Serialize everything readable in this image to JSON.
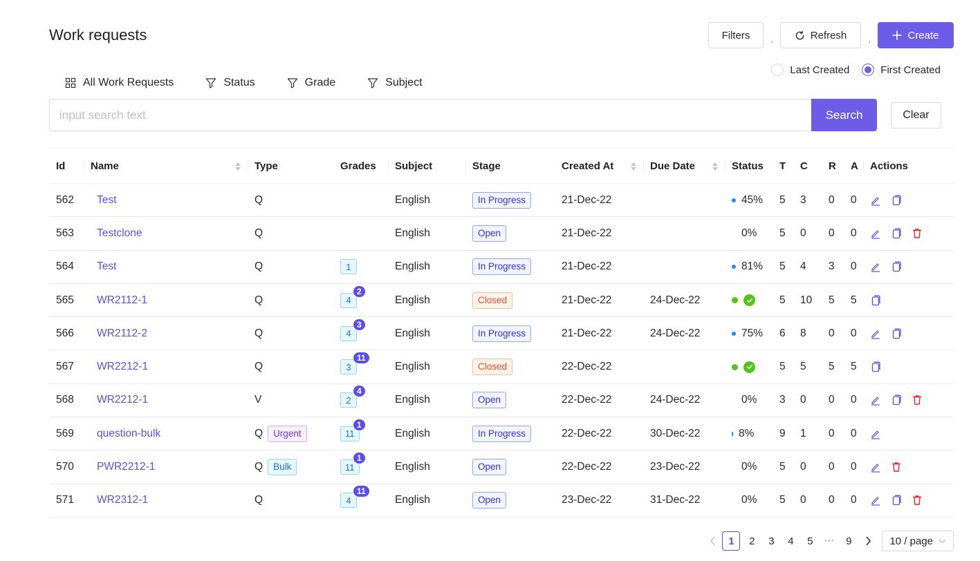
{
  "page": {
    "title": "Work requests"
  },
  "toolbar": {
    "filters_label": "Filters",
    "refresh_label": "Refresh",
    "create_label": "Create",
    "separator": ","
  },
  "sort_options": {
    "last_created": "Last Created",
    "first_created": "First Created",
    "selected": "first_created"
  },
  "tabs": [
    {
      "label": "All Work Requests",
      "icon": "grid-icon"
    },
    {
      "label": "Status",
      "icon": "filter-icon"
    },
    {
      "label": "Grade",
      "icon": "filter-icon"
    },
    {
      "label": "Subject",
      "icon": "filter-icon"
    }
  ],
  "search": {
    "placeholder": "input search text",
    "value": "",
    "button_label": "Search",
    "clear_label": "Clear"
  },
  "table": {
    "columns": {
      "id": "Id",
      "name": "Name",
      "type": "Type",
      "grades": "Grades",
      "subject": "Subject",
      "stage": "Stage",
      "created_at": "Created At",
      "due_date": "Due Date",
      "status": "Status",
      "t": "T",
      "c": "C",
      "r": "R",
      "a": "A",
      "actions": "Actions"
    },
    "rows": [
      {
        "id": "562",
        "name": "Test",
        "type": "Q",
        "type_tag": "",
        "grade": "",
        "grade_badge": "",
        "subject": "English",
        "stage": "In Progress",
        "created": "21-Dec-22",
        "due": "",
        "status_dot": "blue",
        "status_text": "45%",
        "t": "5",
        "c": "3",
        "r": "0",
        "a": "0",
        "actions": [
          "edit",
          "copy"
        ]
      },
      {
        "id": "563",
        "name": "Testclone",
        "type": "Q",
        "type_tag": "",
        "grade": "",
        "grade_badge": "",
        "subject": "English",
        "stage": "Open",
        "created": "21-Dec-22",
        "due": "",
        "status_dot": "",
        "status_text": "0%",
        "t": "5",
        "c": "0",
        "r": "0",
        "a": "0",
        "actions": [
          "edit",
          "copy",
          "delete"
        ]
      },
      {
        "id": "564",
        "name": "Test",
        "type": "Q",
        "type_tag": "",
        "grade": "1",
        "grade_badge": "",
        "subject": "English",
        "stage": "In Progress",
        "created": "21-Dec-22",
        "due": "",
        "status_dot": "blue",
        "status_text": "81%",
        "t": "5",
        "c": "4",
        "r": "3",
        "a": "0",
        "actions": [
          "edit",
          "copy"
        ]
      },
      {
        "id": "565",
        "name": "WR2112-1",
        "type": "Q",
        "type_tag": "",
        "grade": "4",
        "grade_badge": "2",
        "subject": "English",
        "stage": "Closed",
        "created": "21-Dec-22",
        "due": "24-Dec-22",
        "status_dot": "green",
        "status_text": "",
        "t": "5",
        "c": "10",
        "r": "5",
        "a": "5",
        "actions": [
          "copy"
        ]
      },
      {
        "id": "566",
        "name": "WR2112-2",
        "type": "Q",
        "type_tag": "",
        "grade": "4",
        "grade_badge": "3",
        "subject": "English",
        "stage": "In Progress",
        "created": "21-Dec-22",
        "due": "24-Dec-22",
        "status_dot": "blue",
        "status_text": "75%",
        "t": "6",
        "c": "8",
        "r": "0",
        "a": "0",
        "actions": [
          "edit",
          "copy"
        ]
      },
      {
        "id": "567",
        "name": "WR2212-1",
        "type": "Q",
        "type_tag": "",
        "grade": "3",
        "grade_badge": "11",
        "subject": "English",
        "stage": "Closed",
        "created": "22-Dec-22",
        "due": "",
        "status_dot": "green",
        "status_text": "",
        "t": "5",
        "c": "5",
        "r": "5",
        "a": "5",
        "actions": [
          "copy"
        ]
      },
      {
        "id": "568",
        "name": "WR2212-1",
        "type": "V",
        "type_tag": "",
        "grade": "2",
        "grade_badge": "4",
        "subject": "English",
        "stage": "Open",
        "created": "22-Dec-22",
        "due": "24-Dec-22",
        "status_dot": "",
        "status_text": "0%",
        "t": "3",
        "c": "0",
        "r": "0",
        "a": "0",
        "actions": [
          "edit",
          "copy",
          "delete"
        ]
      },
      {
        "id": "569",
        "name": "question-bulk",
        "type": "Q",
        "type_tag": "Urgent",
        "grade": "11",
        "grade_badge": "1",
        "subject": "English",
        "stage": "In Progress",
        "created": "22-Dec-22",
        "due": "30-Dec-22",
        "status_dot": "small",
        "status_text": "8%",
        "t": "9",
        "c": "1",
        "r": "0",
        "a": "0",
        "actions": [
          "edit"
        ]
      },
      {
        "id": "570",
        "name": "PWR2212-1",
        "type": "Q",
        "type_tag": "Bulk",
        "grade": "11",
        "grade_badge": "1",
        "subject": "English",
        "stage": "Open",
        "created": "22-Dec-22",
        "due": "23-Dec-22",
        "status_dot": "",
        "status_text": "0%",
        "t": "5",
        "c": "0",
        "r": "0",
        "a": "0",
        "actions": [
          "edit",
          "delete"
        ]
      },
      {
        "id": "571",
        "name": "WR2312-1",
        "type": "Q",
        "type_tag": "",
        "grade": "4",
        "grade_badge": "11",
        "subject": "English",
        "stage": "Open",
        "created": "23-Dec-22",
        "due": "31-Dec-22",
        "status_dot": "",
        "status_text": "0%",
        "t": "5",
        "c": "0",
        "r": "0",
        "a": "0",
        "actions": [
          "edit",
          "copy",
          "delete"
        ]
      }
    ]
  },
  "pagination": {
    "pages": [
      "1",
      "2",
      "3",
      "4",
      "5"
    ],
    "ellipsis": "•••",
    "last_page": "9",
    "current": "1",
    "page_size": "10 / page"
  },
  "colors": {
    "primary": "#6c5ce7",
    "link": "#5b4ee8",
    "danger": "#f5222d",
    "success": "#52c41a",
    "info": "#1890ff"
  }
}
